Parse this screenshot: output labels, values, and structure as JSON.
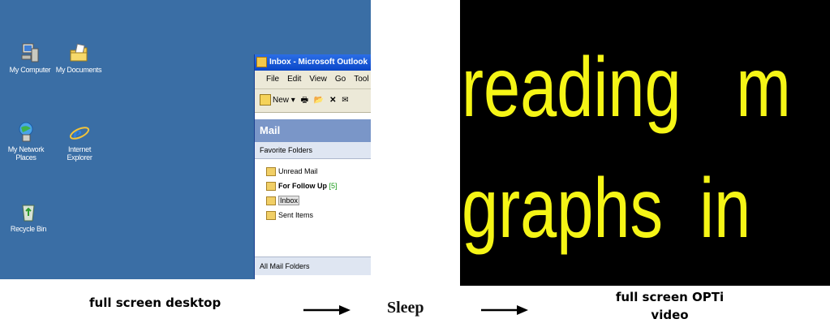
{
  "desktop": {
    "icons": [
      {
        "label": "My Computer",
        "icon": "computer-icon"
      },
      {
        "label": "My Documents",
        "icon": "documents-folder-icon"
      },
      {
        "label": "My Network Places",
        "icon": "network-places-icon"
      },
      {
        "label": "Internet Explorer",
        "icon": "internet-explorer-icon"
      },
      {
        "label": "Recycle Bin",
        "icon": "recycle-bin-icon"
      }
    ],
    "outlook": {
      "title": "Inbox - Microsoft Outlook",
      "menu": [
        "File",
        "Edit",
        "View",
        "Go",
        "Tool"
      ],
      "toolbar_new": "New",
      "pane_header": "Mail",
      "favorite_folders": "Favorite Folders",
      "folders": [
        {
          "name": "Unread Mail"
        },
        {
          "name": "For Follow Up",
          "count": "[5]"
        },
        {
          "name": "Inbox"
        },
        {
          "name": "Sent Items"
        }
      ],
      "all_mail_folders": "All Mail Folders"
    }
  },
  "video": {
    "line1": "reading   m",
    "line2": "graphs  in",
    "text_color": "#f5f516",
    "background": "#000000"
  },
  "captions": {
    "left": "full screen desktop",
    "middle": "Sleep",
    "right_line1": "full screen OPTi",
    "right_line2": "video"
  }
}
